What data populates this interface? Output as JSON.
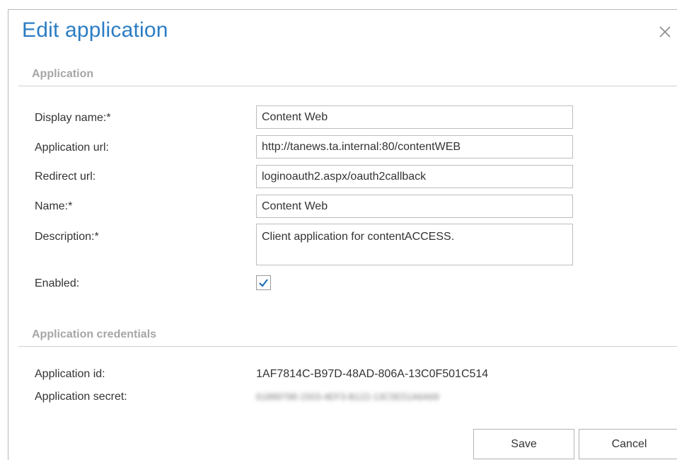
{
  "dialog": {
    "title": "Edit application",
    "close_icon": "close-icon"
  },
  "sections": {
    "application": "Application",
    "credentials": "Application credentials"
  },
  "form": {
    "display_name_label": "Display name:*",
    "display_name_value": "Content Web",
    "application_url_label": "Application url:",
    "application_url_value": "http://tanews.ta.internal:80/contentWEB",
    "redirect_url_label": "Redirect url:",
    "redirect_url_value": "loginoauth2.aspx/oauth2callback",
    "name_label": "Name:*",
    "name_value": "Content Web",
    "description_label": "Description:*",
    "description_value": "Client application for contentACCESS.",
    "enabled_label": "Enabled:",
    "enabled_checked": true
  },
  "credentials": {
    "application_id_label": "Application id:",
    "application_id_value": "1AF7814C-B97D-48AD-806A-13C0F501C514",
    "application_secret_label": "Application secret:",
    "application_secret_value": "61889798-1503-4EF3-B122-13C5E51A6A69"
  },
  "buttons": {
    "save_label": "Save",
    "cancel_label": "Cancel"
  },
  "colors": {
    "title": "#2b7dc4",
    "section_header": "#a6a6a6",
    "checkmark": "#1f6fb8"
  }
}
